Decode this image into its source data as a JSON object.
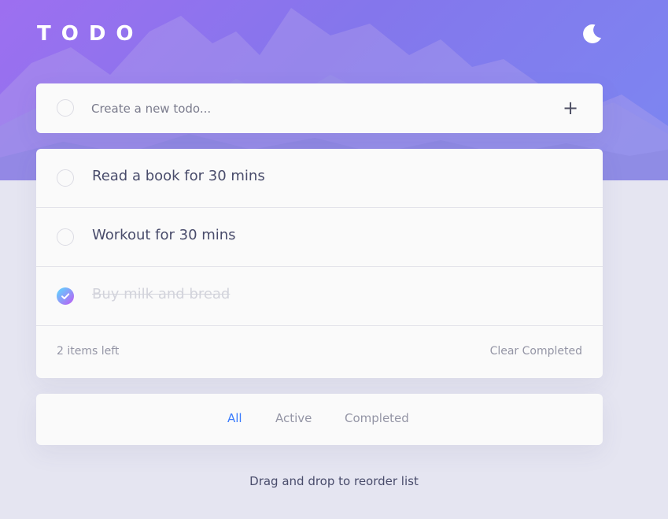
{
  "header": {
    "title": "TODO",
    "theme_toggle_icon": "moon-icon"
  },
  "new_todo": {
    "placeholder": "Create a new todo...",
    "value": "",
    "add_icon": "plus-icon",
    "add_label": "+"
  },
  "todos": [
    {
      "text": "Read a book for 30 mins",
      "completed": false
    },
    {
      "text": "Workout for 30 mins",
      "completed": false
    },
    {
      "text": "Buy milk and bread",
      "completed": true
    }
  ],
  "footer": {
    "items_left": "2 items left",
    "clear_completed": "Clear Completed"
  },
  "filters": {
    "all": "All",
    "active": "Active",
    "completed": "Completed",
    "selected": "All"
  },
  "hint": "Drag and drop to reorder list",
  "colors": {
    "accent": "#3a7cfd",
    "check_gradient_start": "#57ddff",
    "check_gradient_end": "#c058f3",
    "page_bg": "#e5e5f1",
    "card_bg": "#fafafa"
  }
}
